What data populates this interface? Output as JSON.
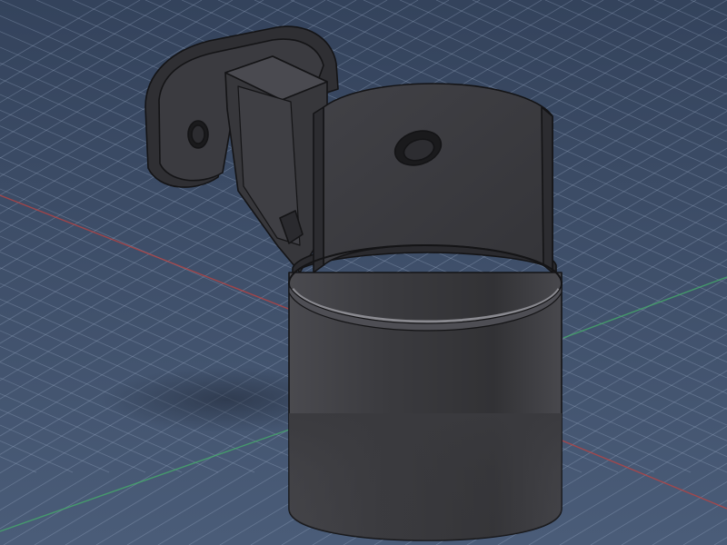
{
  "viewport": {
    "background_top": "#34435c",
    "background_bottom": "#485a76",
    "grid_color": "#9fb0c8",
    "axis_x_color": "#c0413f",
    "axis_y_color": "#45b06a"
  },
  "model": {
    "body_color": "#3a3a3d",
    "body_light": "#55555a",
    "edge_color": "#141416",
    "rim_highlight": "#8a8a90",
    "hole_color": "#1a1a1c"
  },
  "icons": {
    "part": "bracket-clamp-3d-model",
    "mount_hole": "bolt-hole-icon"
  }
}
